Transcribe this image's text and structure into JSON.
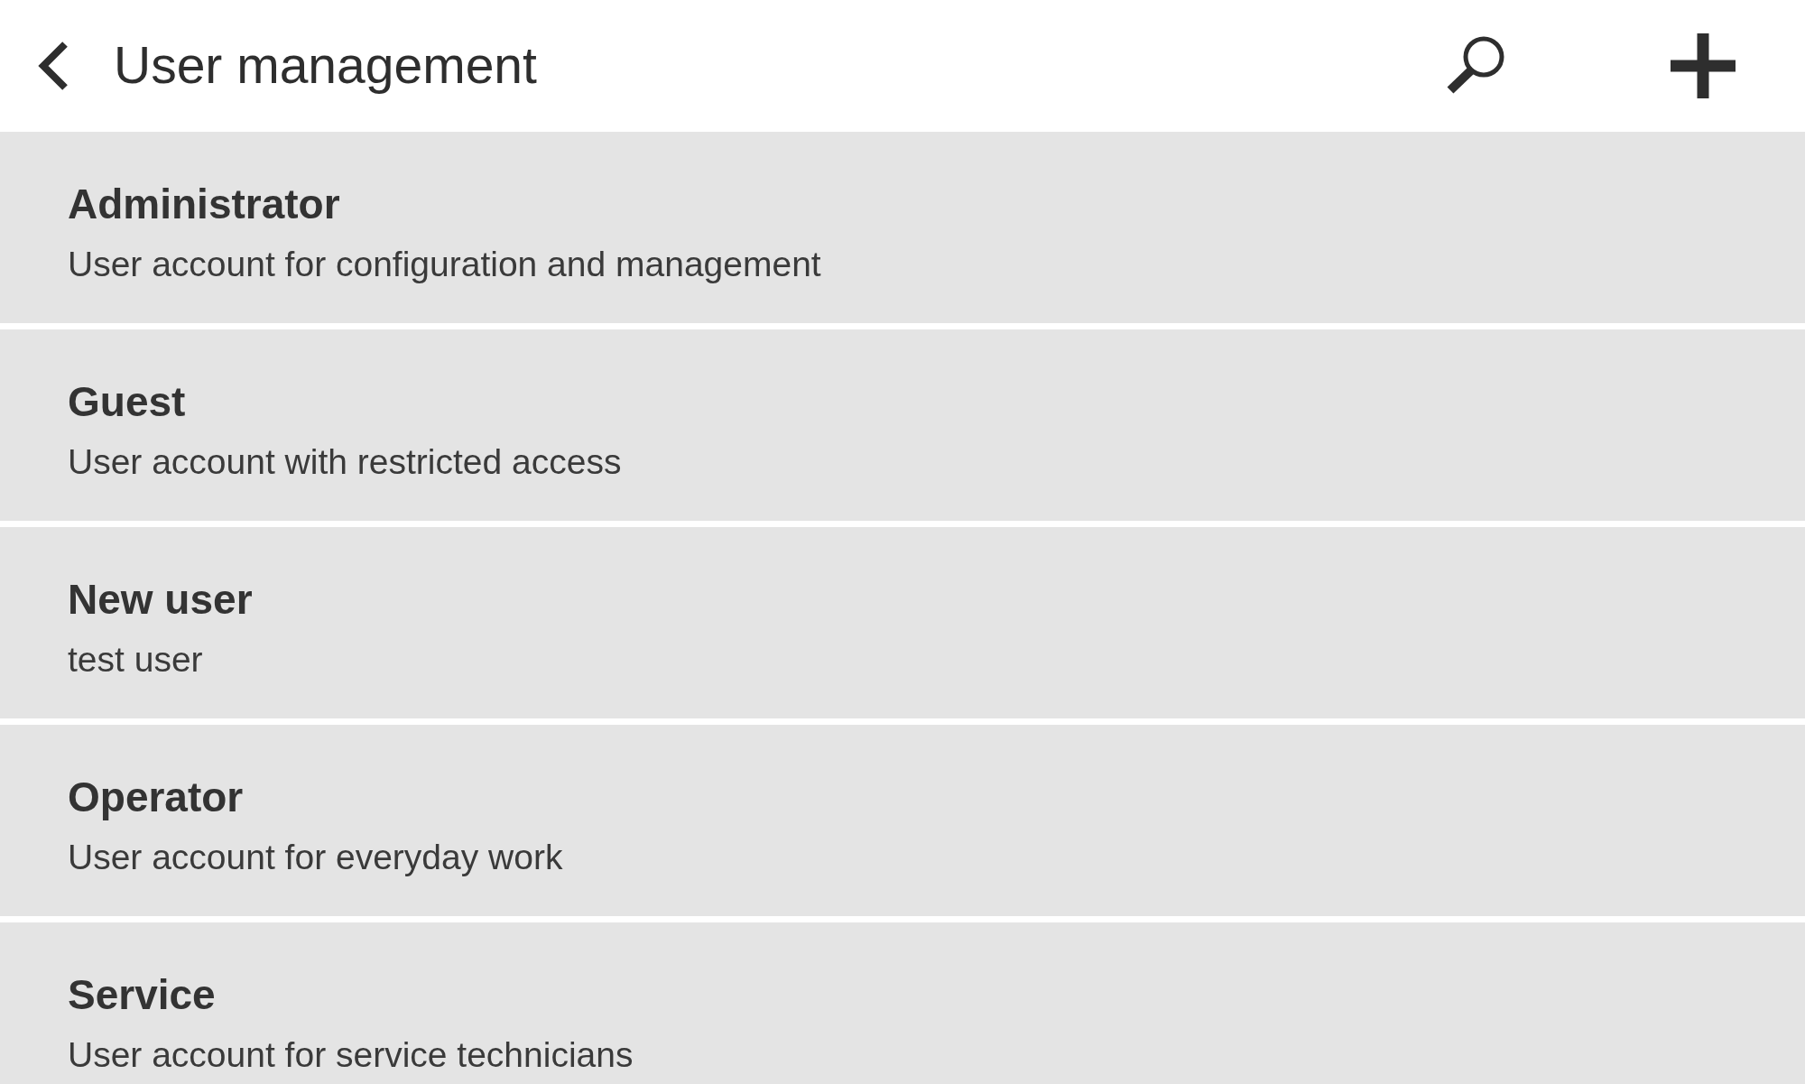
{
  "header": {
    "title": "User management"
  },
  "users": [
    {
      "name": "Administrator",
      "description": "User account for configuration and management"
    },
    {
      "name": "Guest",
      "description": "User account with restricted access"
    },
    {
      "name": "New user",
      "description": "test user"
    },
    {
      "name": "Operator",
      "description": "User account for everyday work"
    },
    {
      "name": "Service",
      "description": "User account for service technicians"
    }
  ]
}
